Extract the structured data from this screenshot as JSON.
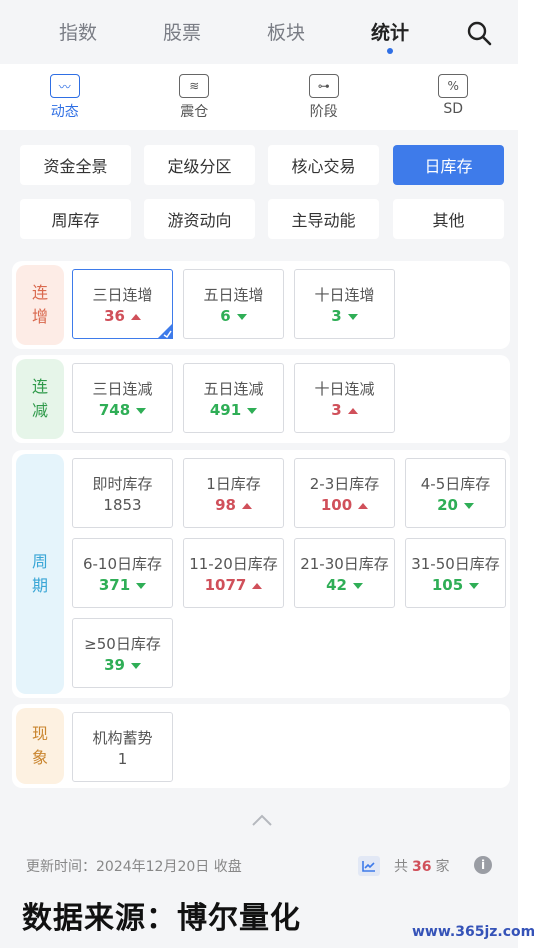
{
  "top_tabs": [
    "指数",
    "股票",
    "板块",
    "统计"
  ],
  "active_top_tab": "统计",
  "sub_tabs": [
    {
      "label": "动态",
      "icon": "trend-chart-icon",
      "glyph": "〰"
    },
    {
      "label": "震仓",
      "icon": "wave-box-icon",
      "glyph": "≋"
    },
    {
      "label": "阶段",
      "icon": "node-line-icon",
      "glyph": "⊶"
    },
    {
      "label": "SD",
      "icon": "percent-icon",
      "glyph": "%"
    }
  ],
  "active_sub_tab": "动态",
  "categories": [
    "资金全景",
    "定级分区",
    "核心交易",
    "日库存",
    "周库存",
    "游资动向",
    "主导动能",
    "其他"
  ],
  "active_category": "日库存",
  "sections": [
    {
      "tag": [
        "连",
        "增"
      ],
      "tag_color": "#d9694e",
      "tag_bg": "#fdece6",
      "cards": [
        {
          "name": "三日连增",
          "value": "36",
          "dir": "up",
          "selected": true
        },
        {
          "name": "五日连增",
          "value": "6",
          "dir": "down"
        },
        {
          "name": "十日连增",
          "value": "3",
          "dir": "down"
        }
      ]
    },
    {
      "tag": [
        "连",
        "减"
      ],
      "tag_color": "#2f9a4a",
      "tag_bg": "#e6f5e9",
      "cards": [
        {
          "name": "三日连减",
          "value": "748",
          "dir": "down"
        },
        {
          "name": "五日连减",
          "value": "491",
          "dir": "down"
        },
        {
          "name": "十日连减",
          "value": "3",
          "dir": "up"
        }
      ]
    },
    {
      "tag": [
        "周",
        "期"
      ],
      "tag_color": "#3aa6d6",
      "tag_bg": "#e5f4fb",
      "cards": [
        {
          "name": "即时库存",
          "value": "1853",
          "dir": "flat"
        },
        {
          "name": "1日库存",
          "value": "98",
          "dir": "up"
        },
        {
          "name": "2-3日库存",
          "value": "100",
          "dir": "up"
        },
        {
          "name": "4-5日库存",
          "value": "20",
          "dir": "down"
        },
        {
          "name": "6-10日库存",
          "value": "371",
          "dir": "down"
        },
        {
          "name": "11-20日库存",
          "value": "1077",
          "dir": "up"
        },
        {
          "name": "21-30日库存",
          "value": "42",
          "dir": "down"
        },
        {
          "name": "31-50日库存",
          "value": "105",
          "dir": "down"
        },
        {
          "name": "≥50日库存",
          "value": "39",
          "dir": "down"
        }
      ]
    },
    {
      "tag": [
        "现",
        "象"
      ],
      "tag_color": "#c9852e",
      "tag_bg": "#fdf1e1",
      "cards": [
        {
          "name": "机构蓄势",
          "value": "1",
          "dir": "flat"
        }
      ]
    }
  ],
  "footer": {
    "update_time": "更新时间：2024年12月20日 收盘",
    "count_prefix": "共",
    "count": "36",
    "count_suffix": "家"
  },
  "source_caption": "数据来源：博尔量化",
  "watermark": "www.365jz.com",
  "colors": {
    "accent": "#3e7bea",
    "up": "#d0505a",
    "down": "#2fae56"
  }
}
